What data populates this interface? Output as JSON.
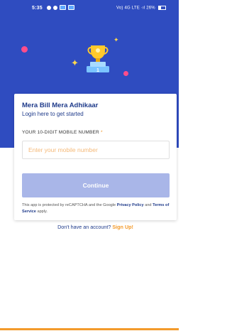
{
  "status_bar": {
    "time": "5:35",
    "right_text": "Vo) 4G LTE ·ıl 26%"
  },
  "login_card": {
    "title": "Mera Bill Mera Adhikaar",
    "subtitle": "Login here to get started",
    "mobile_label": "YOUR 10-DIGIT MOBILE NUMBER",
    "required_mark": "*",
    "mobile_placeholder": "Enter your mobile number",
    "mobile_value": "",
    "continue_label": "Continue",
    "recaptcha_text_1": "This app is protected by reCAPTCHA and the Google ",
    "privacy_label": "Privacy Policy",
    "recaptcha_text_2": " and ",
    "terms_label": "Terms of Service",
    "recaptcha_text_3": " apply.",
    "no_account_text": "Don't have an account?",
    "signup_label": "Sign Up!"
  },
  "colors": {
    "brand_blue": "#2f4cc0",
    "accent_orange": "#f39a2b",
    "button_disabled": "#a9b6e8"
  },
  "icons": [
    "trophy-icon",
    "star-icon",
    "location-icon",
    "wifi-icon",
    "battery-icon"
  ]
}
